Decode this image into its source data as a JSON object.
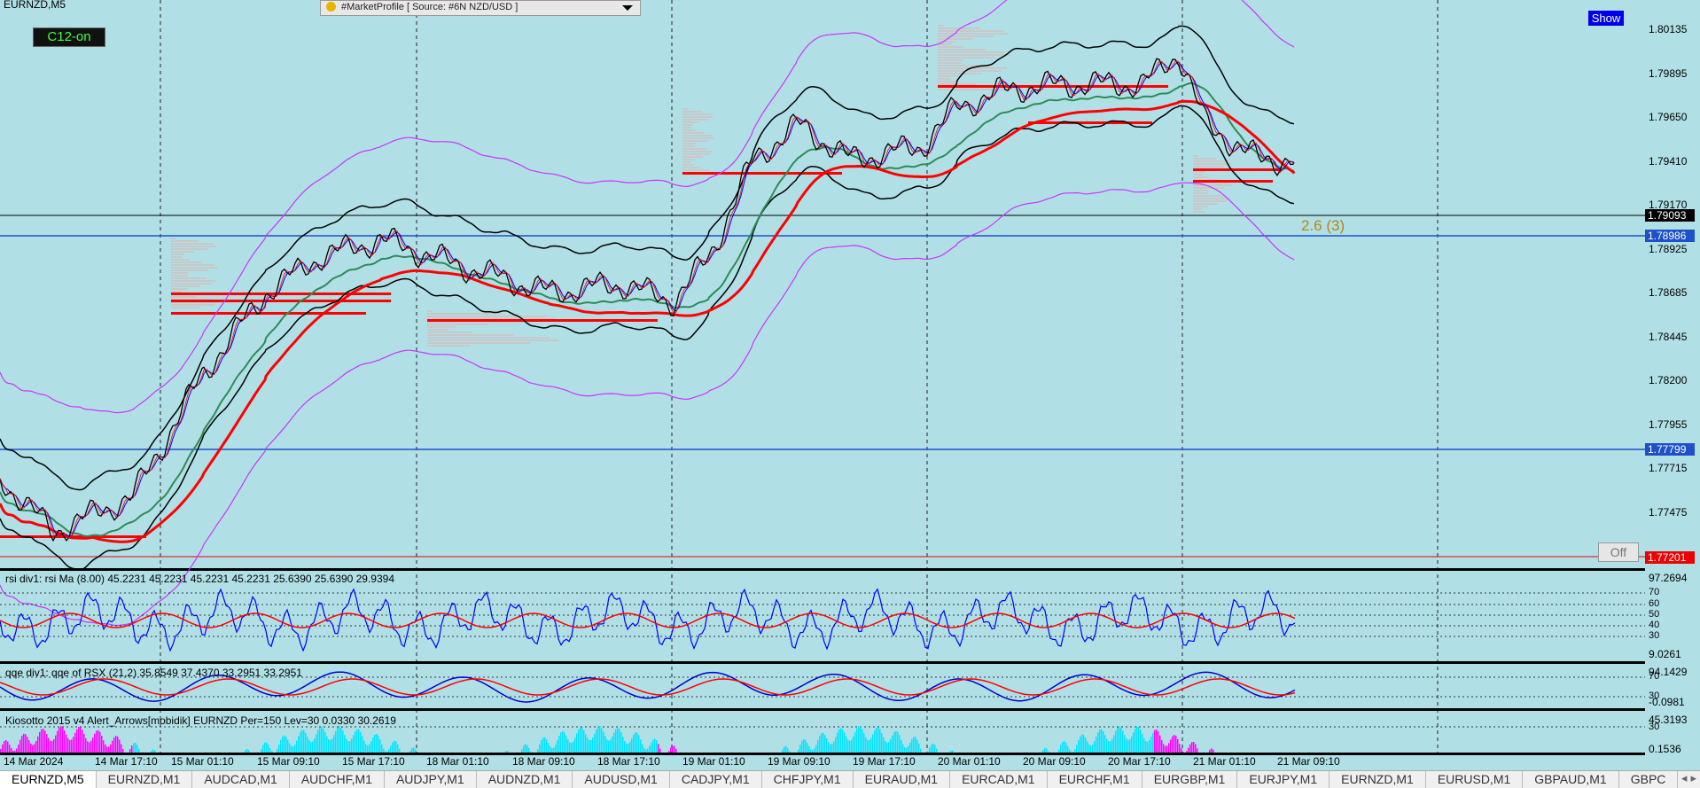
{
  "window": {
    "symbol_title": "EURNZD,M5"
  },
  "overlays": {
    "c12_label": "C12-on",
    "market_profile_combo": "#MarketProfile [ Source: #6N NZD/USD ]",
    "show_button": "Show",
    "off_button": "Off",
    "annotation": "2.6 (3)"
  },
  "price_axis": {
    "labels": [
      "1.80135",
      "1.79895",
      "1.79650",
      "1.79410",
      "1.79170",
      "1.78925",
      "1.78685",
      "1.78445",
      "1.78200",
      "1.77955",
      "1.77715",
      "1.77475",
      "1.77230"
    ],
    "current_price": "1.79093",
    "level_blue_1": "1.78986",
    "level_blue_2": "1.77799",
    "level_red": "1.77201"
  },
  "time_axis": {
    "labels": [
      "14 Mar 2024",
      "14 Mar 17:10",
      "15 Mar 01:10",
      "15 Mar 09:10",
      "15 Mar 17:10",
      "18 Mar 01:10",
      "18 Mar 09:10",
      "18 Mar 17:10",
      "19 Mar 01:10",
      "19 Mar 09:10",
      "19 Mar 17:10",
      "20 Mar 01:10",
      "20 Mar 09:10",
      "20 Mar 17:10",
      "21 Mar 01:10",
      "21 Mar 09:10"
    ]
  },
  "indicators": {
    "rsi": {
      "label": "rsi div1: rsi Ma (8.00) 45.2231 45.2231 45.2231 45.2231 25.6390 25.6390 29.9394",
      "max": "97.2694",
      "min": "9.0261",
      "levels": [
        "70",
        "60",
        "50",
        "40",
        "30"
      ]
    },
    "qqe": {
      "label": "qqe div1: qqe of RSX (21,2) 35.8549 37.4370 33.2951 33.2951",
      "max": "94.1429",
      "min": "-0.0981",
      "levels": [
        "70",
        "30"
      ]
    },
    "kiosotto": {
      "label": "Kiosotto 2015 v4 Alert_Arrows[mobidik] EURNZD Per=150 Lev=30 0.0330 30.2619",
      "max": "45.3193",
      "min": "0.1536",
      "levels": [
        "30"
      ]
    }
  },
  "tabs": [
    "EURNZD,M5",
    "EURNZD,M1",
    "AUDCAD,M1",
    "AUDCHF,M1",
    "AUDJPY,M1",
    "AUDNZD,M1",
    "AUDUSD,M1",
    "CADJPY,M1",
    "CHFJPY,M1",
    "EURAUD,M1",
    "EURCAD,M1",
    "EURCHF,M1",
    "EURGBP,M1",
    "EURJPY,M1",
    "EURNZD,M1",
    "EURUSD,M1",
    "GBPAUD,M1",
    "GBPC"
  ],
  "tab_arrows": "◂ ▸",
  "colors": {
    "background": "#b0e0e6",
    "bull_line": "#ff0000",
    "green_ma": "#2e8b57",
    "envelope": "#cc33ff",
    "rsi_blue": "#0000ff",
    "histo_magenta": "#ff00ff",
    "histo_cyan": "#00e5ff"
  }
}
